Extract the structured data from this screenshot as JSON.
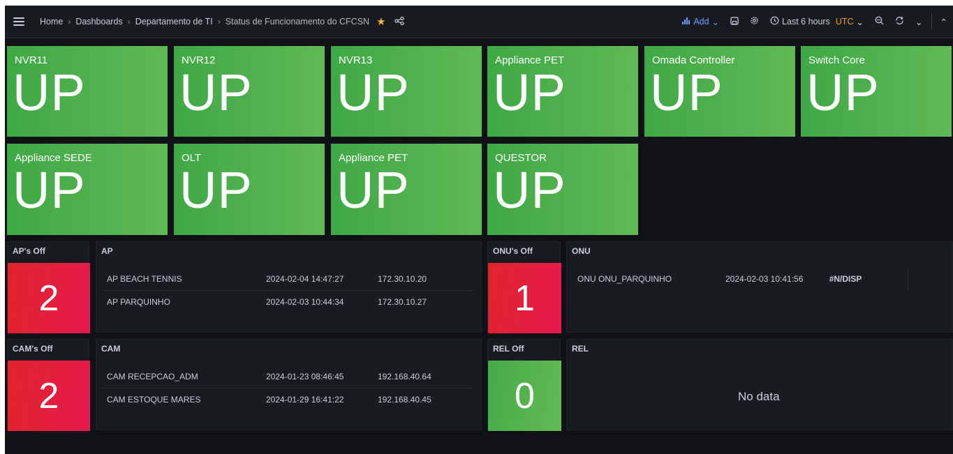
{
  "topbar": {
    "breadcrumb": [
      "Home",
      "Dashboards",
      "Departamento de TI",
      "Status de Funcionamento do CFCSN"
    ],
    "add_label": "Add",
    "time_range": "Last 6 hours",
    "timezone": "UTC"
  },
  "status_panels": [
    {
      "title": "NVR11",
      "value": "UP"
    },
    {
      "title": "NVR12",
      "value": "UP"
    },
    {
      "title": "NVR13",
      "value": "UP"
    },
    {
      "title": "Appliance PET",
      "value": "UP"
    },
    {
      "title": "Omada Controller",
      "value": "UP"
    },
    {
      "title": "Switch Core",
      "value": "UP"
    },
    {
      "title": "Appliance SEDE",
      "value": "UP"
    },
    {
      "title": "OLT",
      "value": "UP"
    },
    {
      "title": "Appliance PET",
      "value": "UP"
    },
    {
      "title": "QUESTOR",
      "value": "UP"
    }
  ],
  "ap": {
    "count_title": "AP's Off",
    "count": "2",
    "table_title": "AP",
    "rows": [
      {
        "name": "AP BEACH TENNIS",
        "time": "2024-02-04 14:47:27",
        "ip": "172.30.10.20"
      },
      {
        "name": "AP PARQUINHO",
        "time": "2024-02-03 10:44:34",
        "ip": "172.30.10.27"
      }
    ]
  },
  "onu": {
    "count_title": "ONU's Off",
    "count": "1",
    "table_title": "ONU",
    "rows": [
      {
        "name": "ONU ONU_PARQUINHO",
        "time": "2024-02-03 10:41:56",
        "ip": "#N/DISP"
      }
    ]
  },
  "cam": {
    "count_title": "CAM's Off",
    "count": "2",
    "table_title": "CAM",
    "rows": [
      {
        "name": "CAM RECEPCAO_ADM",
        "time": "2024-01-23 08:46:45",
        "ip": "192.168.40.64"
      },
      {
        "name": "CAM ESTOQUE MARES",
        "time": "2024-01-29 16:41:22",
        "ip": "192.168.40.45"
      }
    ]
  },
  "rel": {
    "count_title": "REL Off",
    "count": "0",
    "table_title": "REL",
    "empty_text": "No data"
  },
  "colors": {
    "up_green": "#4caf50",
    "alert_red": "#e0252c",
    "background": "#111217",
    "panel": "#181b1f",
    "accent_blue": "#6e9fff",
    "star": "#f5b73b"
  }
}
